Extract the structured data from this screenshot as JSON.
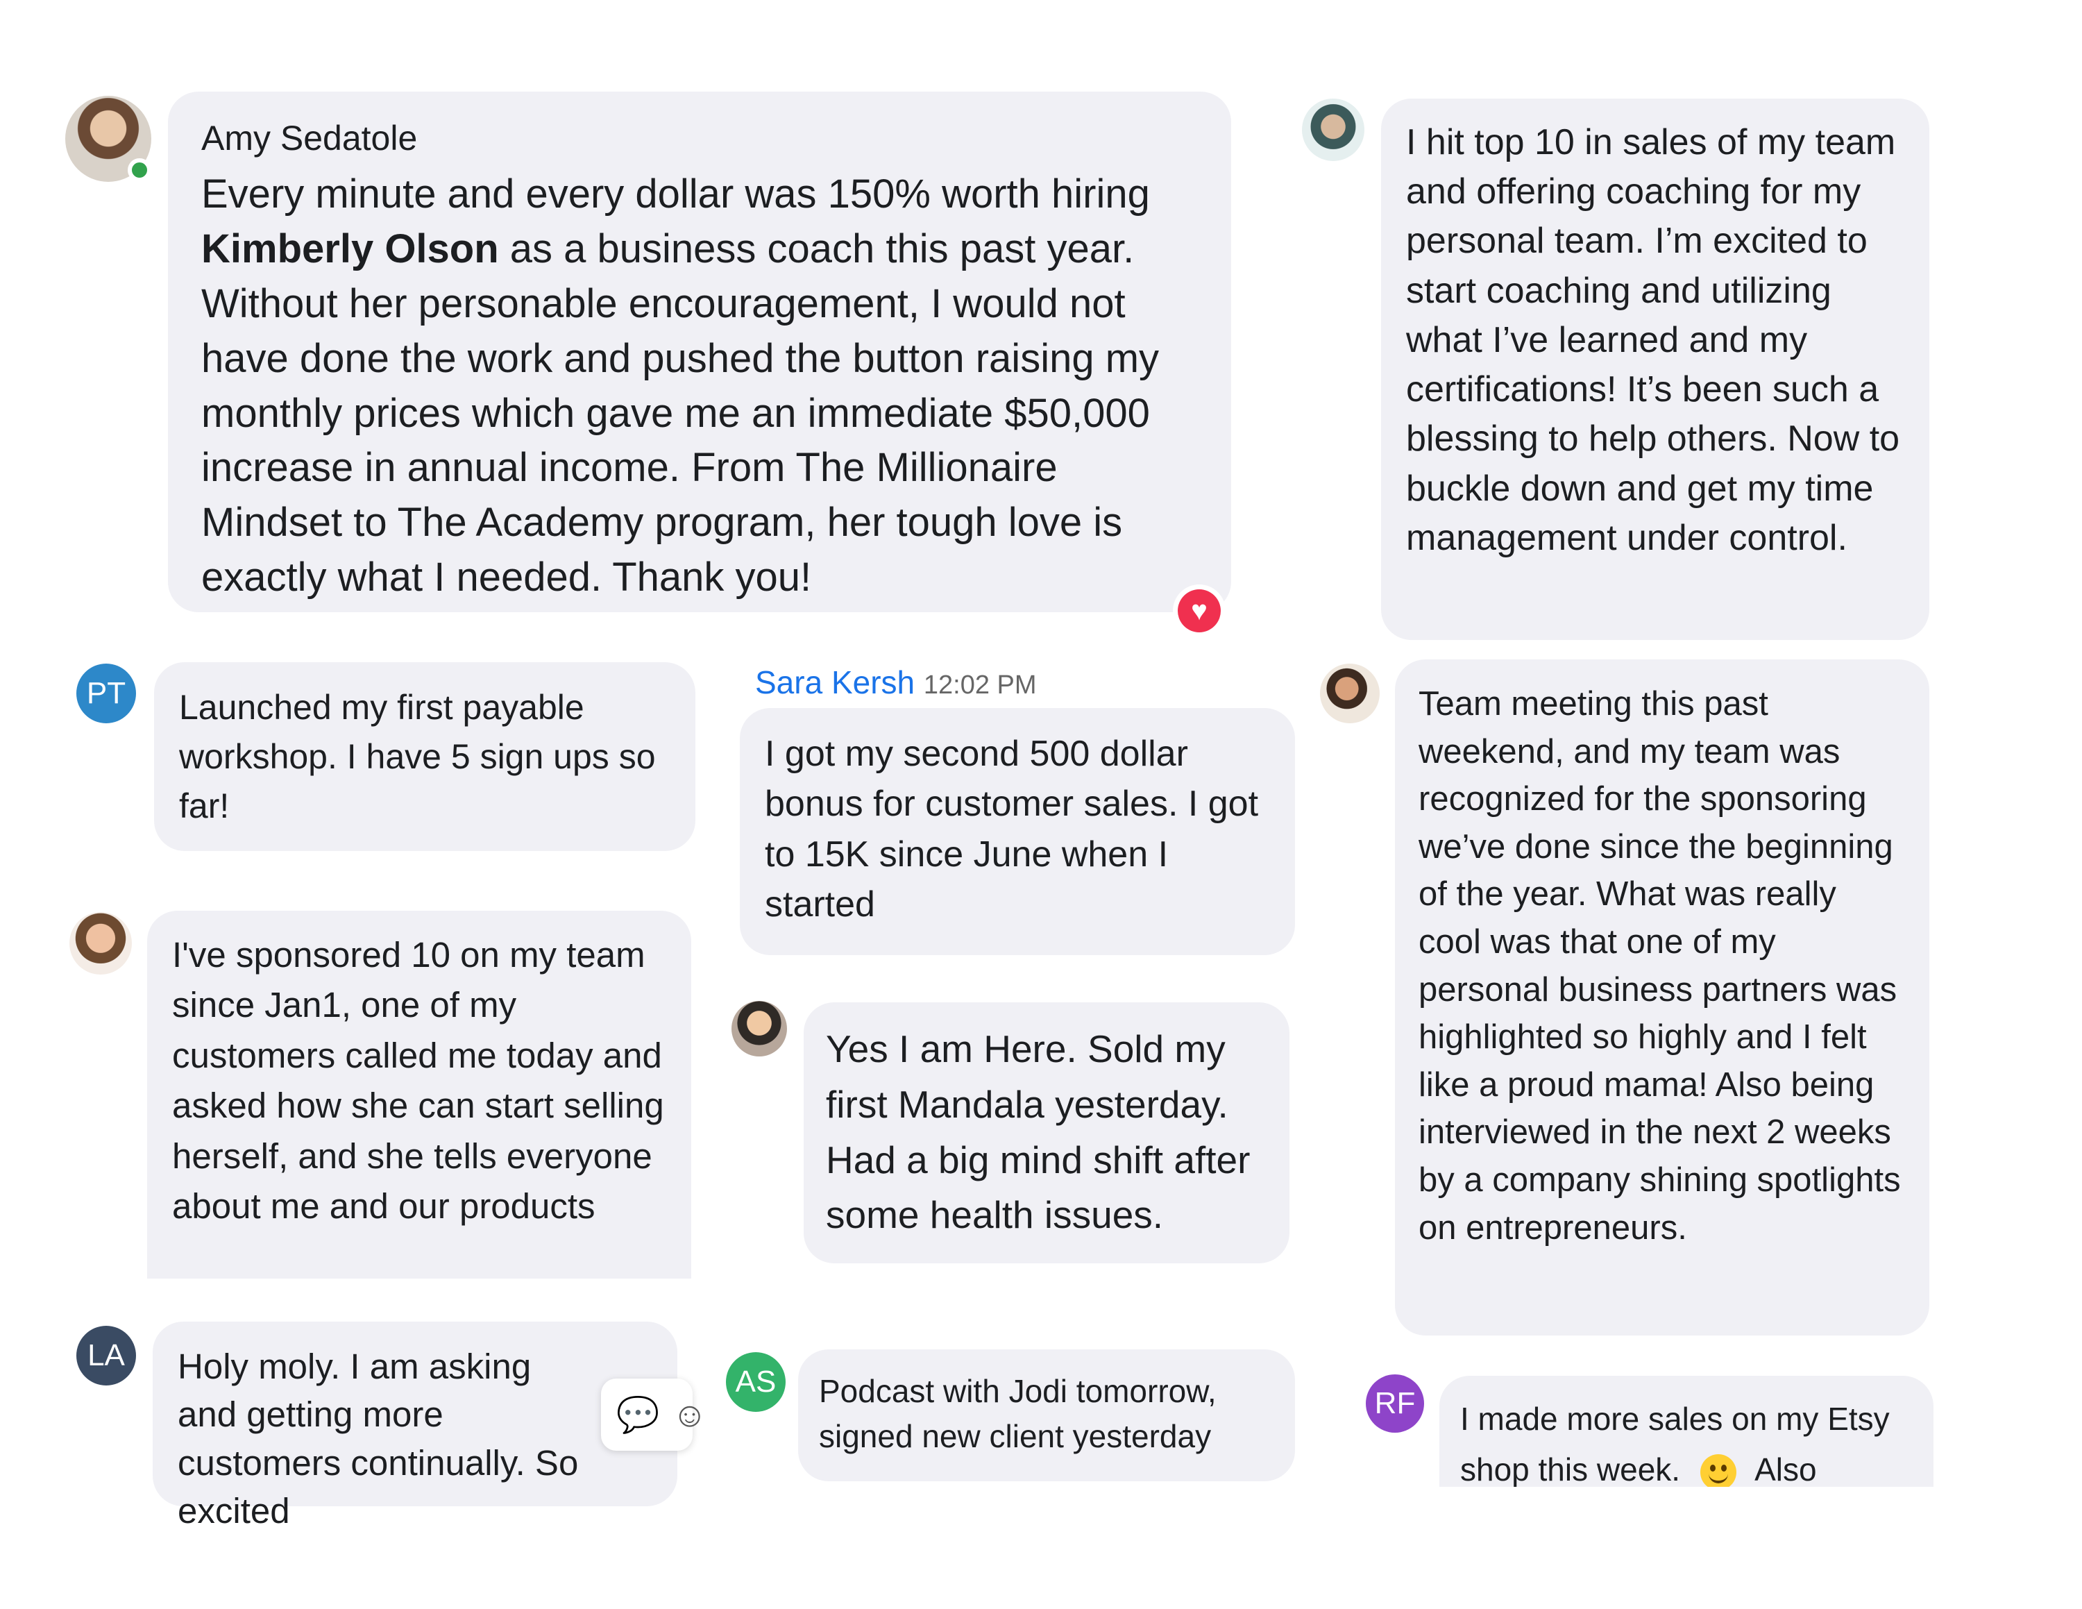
{
  "messages": {
    "amy": {
      "name": "Amy Sedatole",
      "text_before": "Every minute and every dollar was 150% worth hiring ",
      "bold": "Kimberly Olson",
      "text_after": " as a business coach this past year. Without her personable encouragement, I would not have done the work and pushed the button raising my monthly prices which gave me an immediate $50,000 increase in annual income. From The Millionaire Mindset to The Academy program, her tough love is exactly what I needed. Thank you!",
      "reaction": "heart"
    },
    "top10": {
      "text": "I hit top 10 in sales of my team and offering coaching for my personal team. I’m excited to start coaching and utilizing what I’ve learned and my certifications! It’s been such a blessing to help others. Now to buckle down and get my time management under control."
    },
    "pt": {
      "initials": "PT",
      "text": "Launched my first payable workshop. I have 5 sign ups so far!"
    },
    "sara": {
      "name": "Sara Kersh",
      "time": "12:02 PM",
      "text": "I got my second 500 dollar bonus for customer sales. I got to 15K since June when I started"
    },
    "team": {
      "text": "Team meeting this past weekend, and my team was recognized for the sponsoring we’ve done since the beginning of the year. What was really cool was that one of my personal business partners was highlighted so highly and I felt like a proud mama! Also being interviewed in the next 2 weeks by a company shining spotlights on entrepreneurs."
    },
    "sponsor": {
      "text": "I've sponsored 10 on my team since Jan1, one of my customers called me today and asked how she can start selling herself, and she tells everyone about me and our products"
    },
    "mandala": {
      "text": "Yes I am Here. Sold my first Mandala yesterday. Had a big mind shift after some health issues."
    },
    "la": {
      "initials": "LA",
      "text": "Holy moly. I am asking and getting more customers continually. So excited"
    },
    "as": {
      "initials": "AS",
      "text": "Podcast with Jodi tomorrow, signed new client yesterday"
    },
    "rf": {
      "initials": "RF",
      "text": "I made more sales on my Etsy shop this week.",
      "text_tail": "Also"
    }
  },
  "colors": {
    "bubble": "#f0f0f5",
    "pt": "#2d88c9",
    "la": "#3a4b63",
    "as": "#33b36a",
    "rf": "#8e44c9",
    "link_name": "#1a73e8",
    "heart": "#f0304f"
  },
  "icons": {
    "reaction": "heart-icon",
    "reply": "reply-icon",
    "emoji": "smiley-icon"
  }
}
